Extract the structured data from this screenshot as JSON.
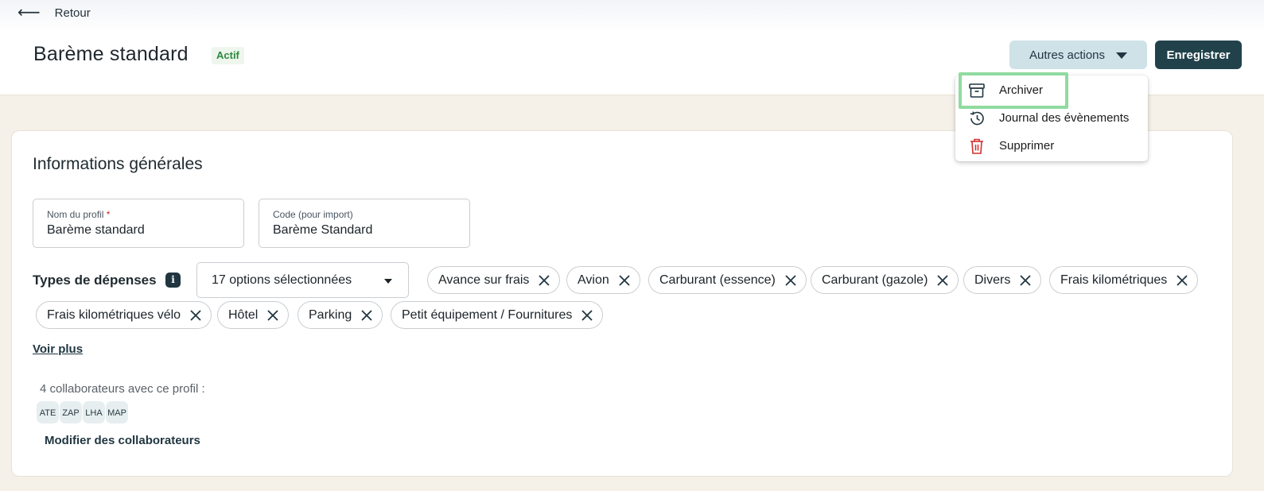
{
  "nav": {
    "back_label": "Retour"
  },
  "header": {
    "title": "Barème standard",
    "status": "Actif",
    "actions_label": "Autres actions",
    "save_label": "Enregistrer"
  },
  "menu": {
    "items": [
      {
        "label": "Archiver",
        "icon": "archive-icon"
      },
      {
        "label": "Journal des évènements",
        "icon": "history-icon"
      },
      {
        "label": "Supprimer",
        "icon": "trash-icon",
        "color": "#d32f2f"
      }
    ]
  },
  "section": {
    "title": "Informations générales",
    "name_field": {
      "label": "Nom du profil",
      "required_mark": "*",
      "value": "Barème standard"
    },
    "code_field": {
      "label": "Code (pour import)",
      "value": "Barème Standard"
    },
    "types": {
      "label": "Types de dépenses",
      "select_value": "17 options sélectionnées",
      "chips": [
        "Avance sur frais",
        "Avion",
        "Carburant (essence)",
        "Carburant (gazole)",
        "Divers",
        "Frais kilométriques",
        "Frais kilométriques vélo",
        "Hôtel",
        "Parking",
        "Petit équipement / Fournitures"
      ]
    },
    "voir_plus": "Voir plus",
    "collaborators": {
      "count_text": "4 collaborateurs avec ce profil :",
      "avatars": [
        "ATE",
        "ZAP",
        "LHA",
        "MAP"
      ],
      "modify_label": "Modifier des collaborateurs"
    }
  },
  "colors": {
    "primary": "#21424b",
    "secondary_button": "#cfe2e8",
    "page_background": "#f5f0e8",
    "highlight": "#90dba0",
    "status_green": "#2b8a3e",
    "danger": "#d32f2f"
  }
}
